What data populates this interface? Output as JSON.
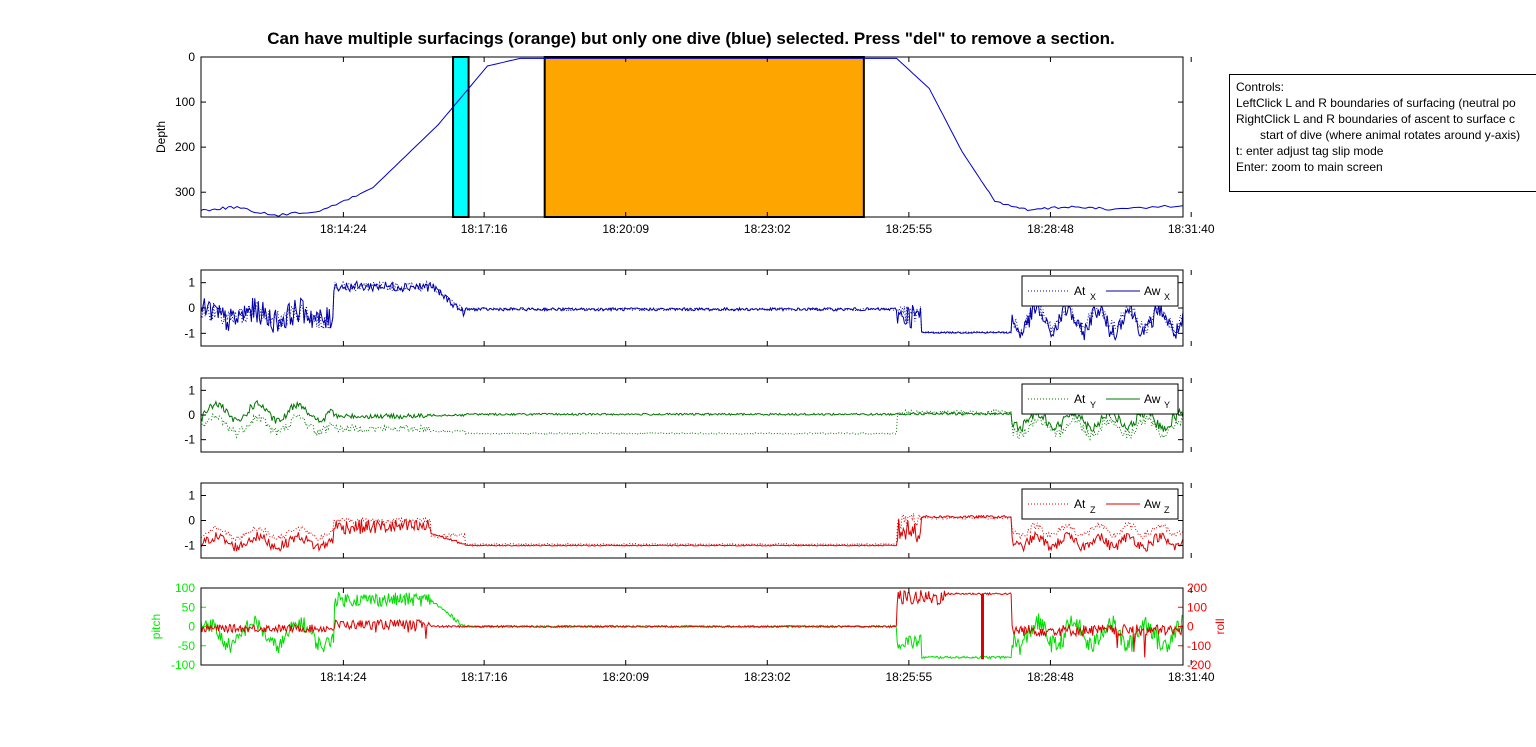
{
  "title": "Can have multiple surfacings (orange) but only one dive (blue) selected.  Press \"del\" to remove a section.",
  "controls": {
    "heading": "Controls:",
    "lines": [
      "LeftClick L and R boundaries of surfacing (neutral po",
      "RightClick L and R boundaries of ascent to surface c",
      "start of dive (where animal rotates around y-axis)",
      "t: enter adjust tag slip mode",
      "Enter: zoom to main screen"
    ]
  },
  "colors": {
    "depth": "#0000cc",
    "x": "#0000aa",
    "y": "#007700",
    "z": "#dd0000",
    "pitch": "#00dd00",
    "roll": "#dd0000",
    "surfacing": "#ffa500",
    "dive": "#00ffff",
    "right_axis": "#ff0000",
    "left_axis_pitch": "#00ee00"
  },
  "chart_data": [
    {
      "type": "line",
      "panel": "depth",
      "ylabel": "Depth",
      "ylim": [
        0,
        355
      ],
      "yticks": [
        0,
        100,
        200,
        300
      ],
      "reversed_y": true,
      "xticks": [
        "18:14:24",
        "18:17:16",
        "18:20:09",
        "18:23:02",
        "18:25:55",
        "18:28:48",
        "18:31:40"
      ],
      "xtick_seconds": [
        65664,
        65836,
        66009,
        66182,
        66355,
        66528,
        66700
      ],
      "xlim_seconds": [
        65490,
        66690
      ],
      "dive_region": [
        65798,
        65817
      ],
      "surfacing_regions": [
        [
          65910,
          66300
        ]
      ],
      "series": [
        {
          "name": "",
          "x": [
            65490,
            65530,
            65580,
            65640,
            65700,
            65780,
            65840,
            65880,
            65950,
            66300,
            66340,
            66380,
            66420,
            66460,
            66500,
            66550,
            66600,
            66690
          ],
          "y": [
            340,
            333,
            352,
            340,
            290,
            150,
            20,
            3,
            3,
            3,
            3,
            70,
            210,
            320,
            340,
            332,
            338,
            330
          ]
        }
      ]
    },
    {
      "type": "line",
      "panel": "acc-x",
      "ylim": [
        -1.5,
        1.5
      ],
      "yticks": [
        1,
        0,
        -1
      ],
      "legend": [
        "At",
        "Aw"
      ],
      "legend_sub": "X"
    },
    {
      "type": "line",
      "panel": "acc-y",
      "ylim": [
        -1.5,
        1.5
      ],
      "yticks": [
        1,
        0,
        -1
      ],
      "legend": [
        "At",
        "Aw"
      ],
      "legend_sub": "Y"
    },
    {
      "type": "line",
      "panel": "acc-z",
      "ylim": [
        -1.5,
        1.5
      ],
      "yticks": [
        1,
        0,
        -1
      ],
      "legend": [
        "At",
        "Aw"
      ],
      "legend_sub": "Z"
    },
    {
      "type": "line",
      "panel": "pitch-roll",
      "ylabel": "pitch",
      "ylabel_right": "roll",
      "ylim": [
        -100,
        100
      ],
      "yticks": [
        100,
        50,
        0,
        -50,
        -100
      ],
      "ylim_right": [
        -200,
        200
      ],
      "yticks_right": [
        200,
        100,
        0,
        -100,
        -200
      ],
      "xticks": [
        "18:14:24",
        "18:17:16",
        "18:20:09",
        "18:23:02",
        "18:25:55",
        "18:28:48",
        "18:31:40"
      ]
    }
  ]
}
